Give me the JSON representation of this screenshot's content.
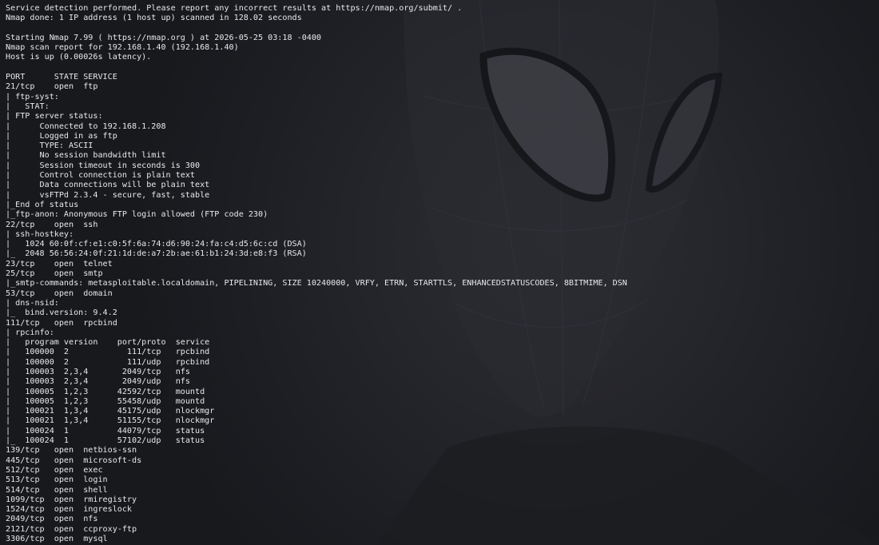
{
  "terminal": {
    "background_color": "#222328",
    "text_color": "#e8e8ec",
    "wallpaper": "spiderman-mask-wallpaper",
    "lines": [
      "Service detection performed. Please report any incorrect results at https://nmap.org/submit/ .",
      "Nmap done: 1 IP address (1 host up) scanned in 128.02 seconds",
      "",
      "Starting Nmap 7.99 ( https://nmap.org ) at 2026-05-25 03:18 -0400",
      "Nmap scan report for 192.168.1.40 (192.168.1.40)",
      "Host is up (0.00026s latency).",
      "",
      "PORT      STATE SERVICE",
      "21/tcp    open  ftp",
      "| ftp-syst:",
      "|   STAT:",
      "| FTP server status:",
      "|      Connected to 192.168.1.208",
      "|      Logged in as ftp",
      "|      TYPE: ASCII",
      "|      No session bandwidth limit",
      "|      Session timeout in seconds is 300",
      "|      Control connection is plain text",
      "|      Data connections will be plain text",
      "|      vsFTPd 2.3.4 - secure, fast, stable",
      "|_End of status",
      "|_ftp-anon: Anonymous FTP login allowed (FTP code 230)",
      "22/tcp    open  ssh",
      "| ssh-hostkey:",
      "|   1024 60:0f:cf:e1:c0:5f:6a:74:d6:90:24:fa:c4:d5:6c:cd (DSA)",
      "|_  2048 56:56:24:0f:21:1d:de:a7:2b:ae:61:b1:24:3d:e8:f3 (RSA)",
      "23/tcp    open  telnet",
      "25/tcp    open  smtp",
      "|_smtp-commands: metasploitable.localdomain, PIPELINING, SIZE 10240000, VRFY, ETRN, STARTTLS, ENHANCEDSTATUSCODES, 8BITMIME, DSN",
      "53/tcp    open  domain",
      "| dns-nsid:",
      "|_  bind.version: 9.4.2",
      "111/tcp   open  rpcbind",
      "| rpcinfo:",
      "|   program version    port/proto  service",
      "|   100000  2            111/tcp   rpcbind",
      "|   100000  2            111/udp   rpcbind",
      "|   100003  2,3,4       2049/tcp   nfs",
      "|   100003  2,3,4       2049/udp   nfs",
      "|   100005  1,2,3      42592/tcp   mountd",
      "|   100005  1,2,3      55458/udp   mountd",
      "|   100021  1,3,4      45175/udp   nlockmgr",
      "|   100021  1,3,4      51155/tcp   nlockmgr",
      "|   100024  1          44079/tcp   status",
      "|_  100024  1          57102/udp   status",
      "139/tcp   open  netbios-ssn",
      "445/tcp   open  microsoft-ds",
      "512/tcp   open  exec",
      "513/tcp   open  login",
      "514/tcp   open  shell",
      "1099/tcp  open  rmiregistry",
      "1524/tcp  open  ingreslock",
      "2049/tcp  open  nfs",
      "2121/tcp  open  ccproxy-ftp",
      "3306/tcp  open  mysql"
    ]
  }
}
